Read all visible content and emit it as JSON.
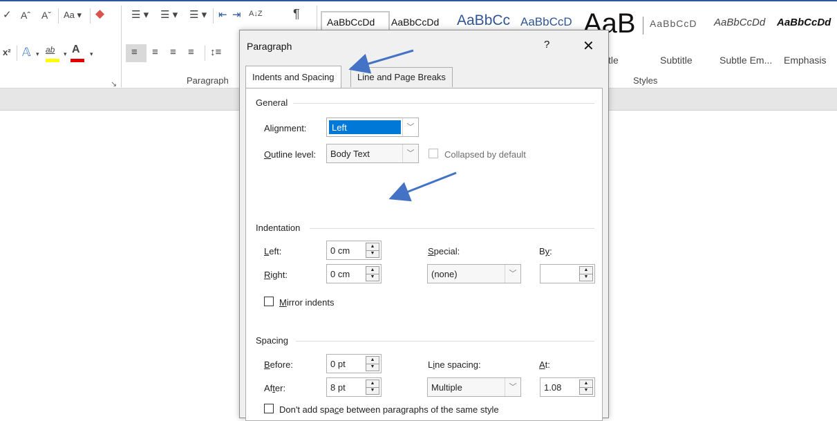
{
  "ribbon": {
    "paragraph_group_label": "Paragraph",
    "styles_group_label": "Styles",
    "style_previews": [
      {
        "preview": "AaBbCcDd",
        "name": ""
      },
      {
        "preview": "AaBbCcDd",
        "name": ""
      },
      {
        "preview": "AaBbCc",
        "name": ""
      },
      {
        "preview": "AaBbCcD",
        "name": ""
      },
      {
        "preview": "AaB",
        "name": "tle"
      },
      {
        "preview": "AaBbCcD",
        "name": "Subtitle"
      },
      {
        "preview": "AaBbCcDd",
        "name": "Subtle Em..."
      },
      {
        "preview": "AaBbCcDd",
        "name": "Emphasis"
      }
    ],
    "font_buttons": {
      "change_case": "Aa",
      "superscript": "x²",
      "font_color": "A",
      "highlight": "ab"
    },
    "pilcrow": "¶",
    "sort": "A↓Z"
  },
  "dialog": {
    "title": "Paragraph",
    "help": "?",
    "close": "✕",
    "tabs": [
      {
        "label": "Indents and Spacing",
        "selected": true
      },
      {
        "label": "Line and Page Breaks",
        "selected": false
      }
    ],
    "general": {
      "heading": "General",
      "alignment_label": "Alignment:",
      "alignment_value": "Left",
      "outline_label": "Outline level:",
      "outline_value": "Body Text",
      "collapsed_label": "Collapsed by default"
    },
    "indentation": {
      "heading": "Indentation",
      "left_label": "Left:",
      "left_value": "0 cm",
      "right_label": "Right:",
      "right_value": "0 cm",
      "special_label": "Special:",
      "special_value": "(none)",
      "by_label": "By:",
      "by_value": "",
      "mirror_label": "Mirror indents"
    },
    "spacing": {
      "heading": "Spacing",
      "before_label": "Before:",
      "before_value": "0 pt",
      "after_label": "After:",
      "after_value": "8 pt",
      "line_spacing_label": "Line spacing:",
      "line_spacing_value": "Multiple",
      "at_label": "At:",
      "at_value": "1.08",
      "dont_add_label": "Don't add space between paragraphs of the same style"
    }
  },
  "colors": {
    "accent": "#2b579a",
    "selection": "#0078d7",
    "annotation_arrow": "#4472c4",
    "highlight_yellow": "#ffff00",
    "font_red": "#e00000"
  }
}
